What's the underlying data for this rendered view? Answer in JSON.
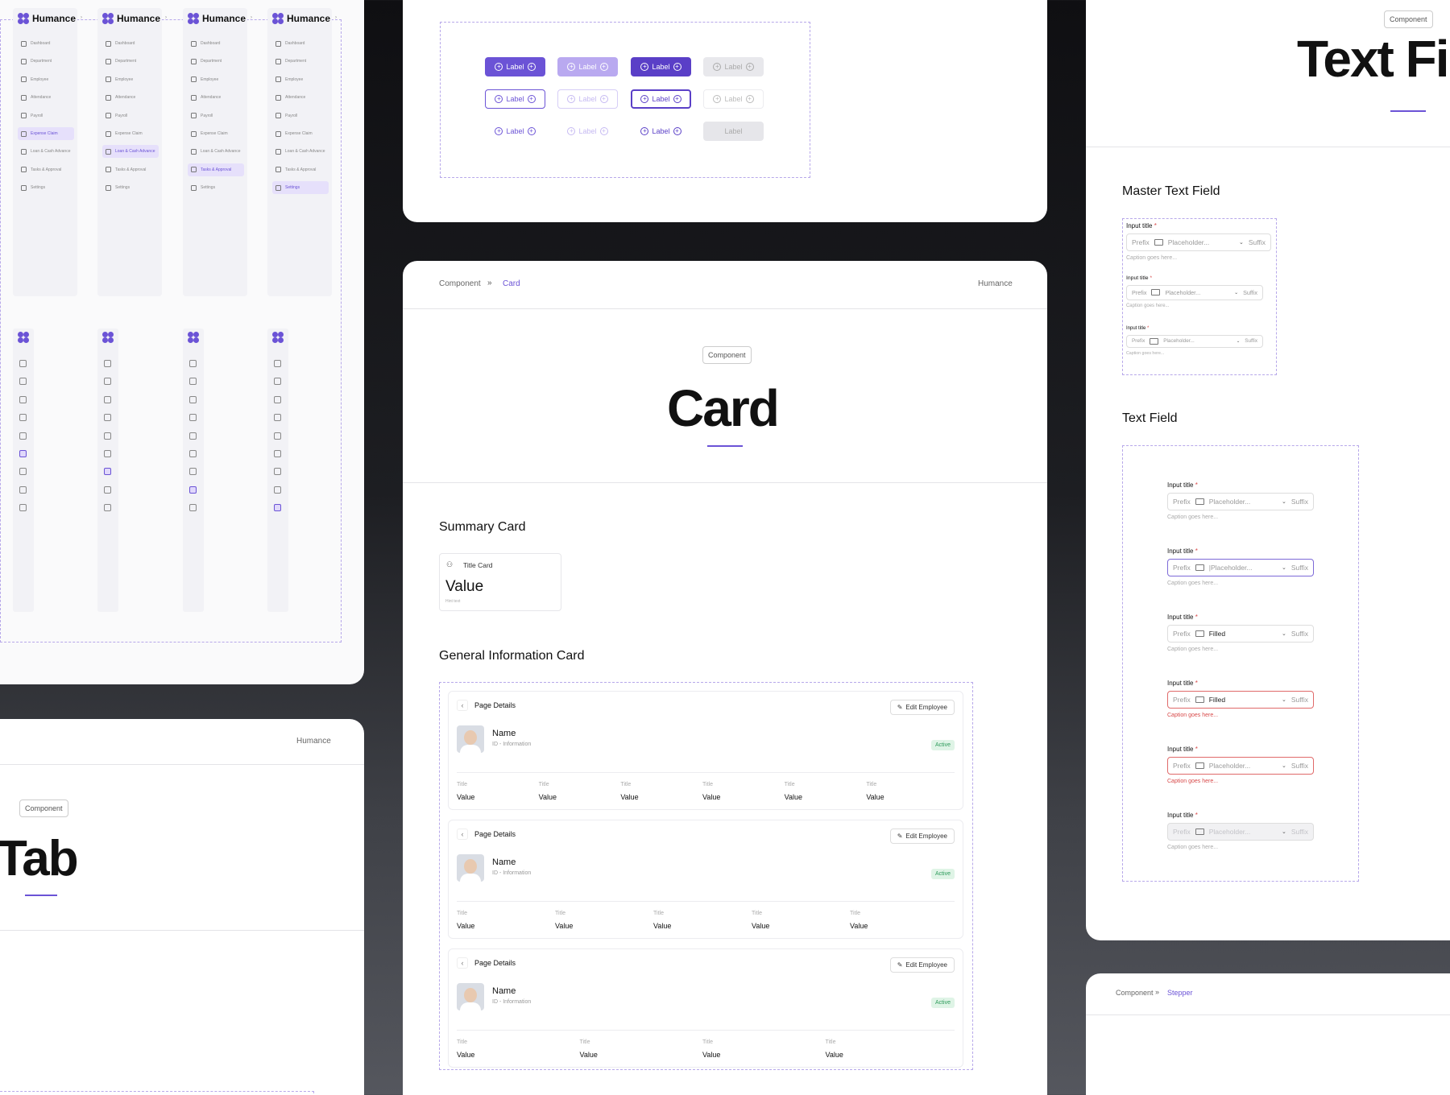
{
  "brand": "Humance",
  "nav": {
    "items": [
      "Dashboard",
      "Department",
      "Employee",
      "Attendance",
      "Payroll",
      "Expense Claim",
      "Loan & Cash Advance",
      "Tasks & Approval",
      "Settings"
    ],
    "selected_per_column": [
      5,
      6,
      7,
      8
    ]
  },
  "buttons": {
    "label": "Label"
  },
  "card_page": {
    "breadcrumb_root": "Component",
    "breadcrumb_sep": "»",
    "breadcrumb_current": "Card",
    "brand": "Humance",
    "badge": "Component",
    "title": "Card",
    "summary_heading": "Summary Card",
    "summary_card": {
      "title": "Title Card",
      "value": "Value",
      "hint": "Hint text"
    },
    "general_heading": "General Information Card",
    "general_cards": [
      {
        "header": "Page Details",
        "edit": "Edit Employee",
        "name": "Name",
        "sub": "ID - Information",
        "status": "Active",
        "fields": [
          {
            "t": "Title",
            "v": "Value"
          },
          {
            "t": "Title",
            "v": "Value"
          },
          {
            "t": "Title",
            "v": "Value"
          },
          {
            "t": "Title",
            "v": "Value"
          },
          {
            "t": "Title",
            "v": "Value"
          },
          {
            "t": "Title",
            "v": "Value"
          }
        ]
      },
      {
        "header": "Page Details",
        "edit": "Edit Employee",
        "name": "Name",
        "sub": "ID - Information",
        "status": "Active",
        "fields": [
          {
            "t": "Title",
            "v": "Value"
          },
          {
            "t": "Title",
            "v": "Value"
          },
          {
            "t": "Title",
            "v": "Value"
          },
          {
            "t": "Title",
            "v": "Value"
          },
          {
            "t": "Title",
            "v": "Value"
          }
        ]
      },
      {
        "header": "Page Details",
        "edit": "Edit Employee",
        "name": "Name",
        "sub": "ID - Information",
        "status": "Active",
        "fields": [
          {
            "t": "Title",
            "v": "Value"
          },
          {
            "t": "Title",
            "v": "Value"
          },
          {
            "t": "Title",
            "v": "Value"
          },
          {
            "t": "Title",
            "v": "Value"
          }
        ]
      }
    ]
  },
  "tab_page": {
    "brand": "Humance",
    "badge": "Component",
    "title": "Tab"
  },
  "textfield_page": {
    "badge": "Component",
    "title": "Text Fi",
    "master_heading": "Master Text Field",
    "heading": "Text Field",
    "master_fields": [
      {
        "label": "Input title",
        "prefix": "Prefix",
        "placeholder": "Placeholder...",
        "suffix": "Suffix",
        "caption": "Caption goes here..."
      },
      {
        "label": "Input title",
        "prefix": "Prefix",
        "placeholder": "Placeholder...",
        "suffix": "Suffix",
        "caption": "Caption goes here..."
      },
      {
        "label": "Input title",
        "prefix": "Prefix",
        "placeholder": "Placeholder...",
        "suffix": "Suffix",
        "caption": "Caption goes here..."
      }
    ],
    "fields": [
      {
        "label": "Input title",
        "prefix": "Prefix",
        "value": "Placeholder...",
        "suffix": "Suffix",
        "caption": "Caption goes here...",
        "state": "default"
      },
      {
        "label": "Input title",
        "prefix": "Prefix",
        "value": "|Placeholder...",
        "suffix": "Suffix",
        "caption": "Caption goes here...",
        "state": "focus"
      },
      {
        "label": "Input title",
        "prefix": "Prefix",
        "value": "Filled",
        "suffix": "Suffix",
        "caption": "Caption goes here...",
        "state": "filled"
      },
      {
        "label": "Input title",
        "prefix": "Prefix",
        "value": "Filled",
        "suffix": "Suffix",
        "caption": "Caption goes here...",
        "state": "error-filled"
      },
      {
        "label": "Input title",
        "prefix": "Prefix",
        "value": "Placeholder...",
        "suffix": "Suffix",
        "caption": "Caption goes here...",
        "state": "error"
      },
      {
        "label": "Input title",
        "prefix": "Prefix",
        "value": "Placeholder...",
        "suffix": "Suffix",
        "caption": "Caption goes here...",
        "state": "disabled"
      }
    ]
  },
  "stepper_page": {
    "breadcrumb_root": "Component",
    "breadcrumb_sep": "»",
    "breadcrumb_current": "Stepper"
  },
  "colors": {
    "accent": "#6b53d6",
    "accent_light": "#b3a3ee",
    "success": "#2e9b5b",
    "error": "#d84a4a"
  }
}
